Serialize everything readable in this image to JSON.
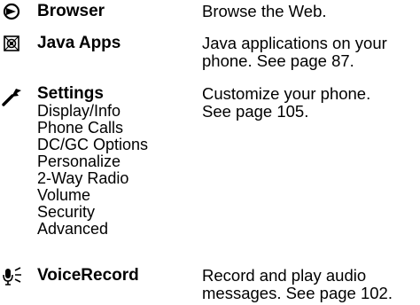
{
  "entries": [
    {
      "icon": "globe-icon",
      "title": "Browser",
      "description": [
        "Browse the Web."
      ],
      "subitems": []
    },
    {
      "icon": "java-apps-icon",
      "title": "Java Apps",
      "description": [
        "Java applications on your",
        "phone. See page 87."
      ],
      "subitems": []
    },
    {
      "icon": "settings-icon",
      "title": "Settings",
      "description": [
        "Customize your phone.",
        "See page 105."
      ],
      "subitems": [
        "Display/Info",
        "Phone Calls",
        "DC/GC Options",
        "Personalize",
        "2-Way Radio",
        "Volume",
        "Security",
        "Advanced"
      ]
    },
    {
      "icon": "voice-record-icon",
      "title": "VoiceRecord",
      "description": [
        "Record and play audio",
        "messages. See page 102."
      ],
      "subitems": []
    }
  ]
}
